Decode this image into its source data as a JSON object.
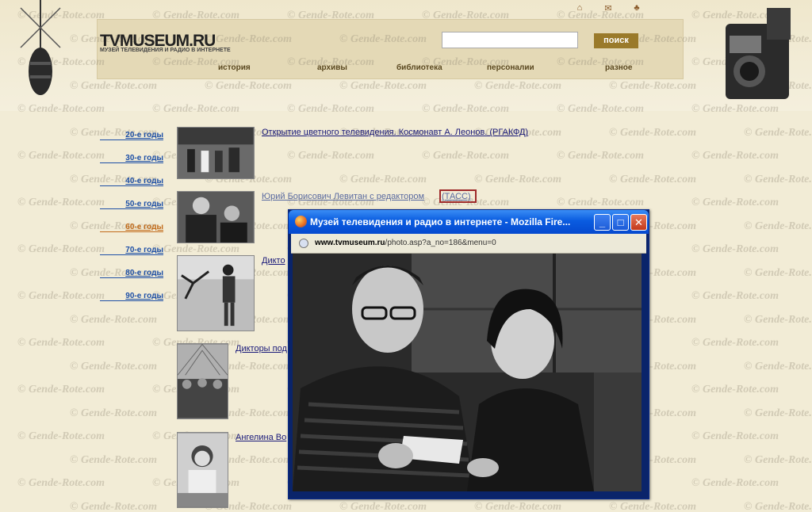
{
  "site": {
    "logo": "TVMUSEUM.RU",
    "logo_sub": "МУЗЕЙ ТЕЛЕВИДЕНИЯ И РАДИО В ИНТЕРНЕТЕ",
    "search_button": "поиск",
    "search_watermark": "© Gende-Rote.com",
    "top_icons": [
      "home-icon",
      "mail-icon",
      "sitemap-icon"
    ],
    "nav": [
      "история",
      "архивы",
      "библиотека",
      "персоналии",
      "разное"
    ]
  },
  "decades": [
    "20-е годы",
    "30-е годы",
    "40-е годы",
    "50-е годы",
    "60-е годы",
    "70-е годы",
    "80-е годы",
    "90-е годы"
  ],
  "active_decade": "60-е годы",
  "photos": [
    {
      "caption": "Открытие цветного телевидения. Космонавт А. Леонов. (РГАКФД)"
    },
    {
      "caption": "Юрий Борисович Левитан с редактором",
      "source": "(ТАСС)"
    },
    {
      "caption": "Дикто"
    },
    {
      "caption": "Дикторы под"
    },
    {
      "caption": "Ангелина Во"
    }
  ],
  "watermark": "© Gende-Rote.com",
  "popup": {
    "title": "Музей телевидения и радио в интернете - Mozilla Fire...",
    "url_host": "www.tvmuseum.ru",
    "url_path": "/photo.asp?a_no=186&menu=0",
    "buttons": {
      "minimize": "_",
      "maximize": "□",
      "close": "✕"
    }
  },
  "colors": {
    "link": "#1a1a7a",
    "decade": "#1d4fa6",
    "decade_active": "#c26b1a",
    "titlebar": "#0a5ce0",
    "highlight_box": "#9e2a2a"
  }
}
